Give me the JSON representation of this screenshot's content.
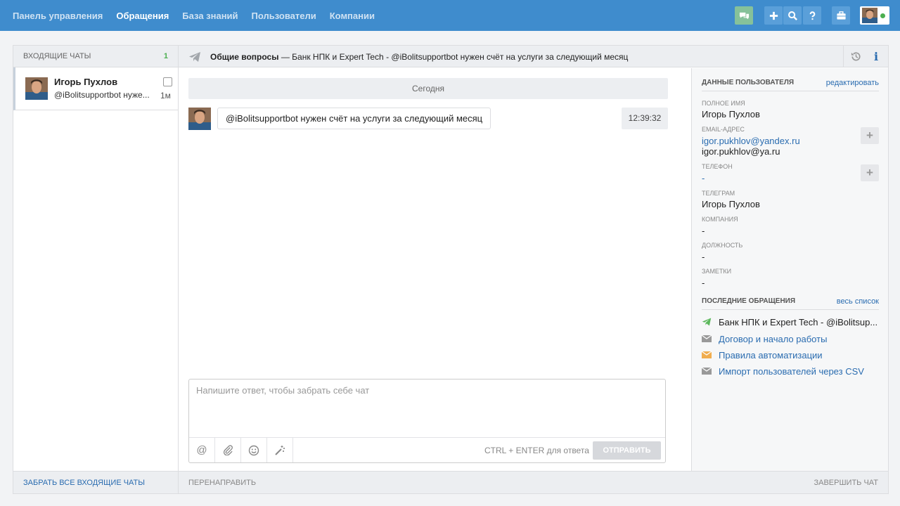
{
  "nav": {
    "items": [
      {
        "label": "Панель управления",
        "active": false
      },
      {
        "label": "Обращения",
        "active": true
      },
      {
        "label": "База знаний",
        "active": false
      },
      {
        "label": "Пользователи",
        "active": false
      },
      {
        "label": "Компании",
        "active": false
      }
    ]
  },
  "inbox": {
    "header": "ВХОДЯЩИЕ ЧАТЫ",
    "count": "1",
    "chats": [
      {
        "name": "Игорь Пухлов",
        "preview": "@iBolitsupportbot нуже...",
        "time": "1м"
      }
    ],
    "footer": "ЗАБРАТЬ ВСЕ ВХОДЯЩИЕ ЧАТЫ"
  },
  "conversation": {
    "topic": "Общие вопросы",
    "dash": "—",
    "subject": "Банк НПК и Expert Tech - @iBolitsupportbot нужен счёт на услуги за следующий месяц",
    "day_label": "Сегодня",
    "message": {
      "text": "@iBolitsupportbot нужен счёт на услуги за следующий месяц",
      "time": "12:39:32"
    },
    "reply_placeholder": "Напишите ответ, чтобы забрать себе чат",
    "hint": "CTRL + ENTER для ответа",
    "send_label": "ОТПРАВИТЬ",
    "redirect_label": "ПЕРЕНАПРАВИТЬ",
    "finish_label": "ЗАВЕРШИТЬ ЧАТ"
  },
  "user_panel": {
    "title": "ДАННЫЕ ПОЛЬЗОВАТЕЛЯ",
    "edit_label": "редактировать",
    "full_name_label": "ПОЛНОЕ ИМЯ",
    "full_name": "Игорь Пухлов",
    "email_label": "EMAIL-АДРЕС",
    "email_primary": "igor.pukhlov@yandex.ru",
    "email_secondary": "igor.pukhlov@ya.ru",
    "phone_label": "ТЕЛЕФОН",
    "phone": "-",
    "telegram_label": "ТЕЛЕГРАМ",
    "telegram": "Игорь Пухлов",
    "company_label": "КОМПАНИЯ",
    "company": "-",
    "position_label": "ДОЛЖНОСТЬ",
    "position": "-",
    "notes_label": "ЗАМЕТКИ",
    "notes": "-"
  },
  "recent": {
    "title": "ПОСЛЕДНИЕ ОБРАЩЕНИЯ",
    "all_label": "весь список",
    "items": [
      {
        "label": "Банк НПК и Expert Tech - @iBolitsup...",
        "icon": "telegram-icon",
        "color": "#5cb85c"
      },
      {
        "label": "Договор и начало работы",
        "icon": "mail-icon",
        "color": "#999999"
      },
      {
        "label": "Правила автоматизации",
        "icon": "mail-icon",
        "color": "#f0ad4e"
      },
      {
        "label": "Импорт пользователей через CSV",
        "icon": "mail-icon",
        "color": "#999999"
      }
    ]
  },
  "colors": {
    "brand": "#3f8ccd",
    "link": "#2a6cb0",
    "online": "#4caf50"
  }
}
